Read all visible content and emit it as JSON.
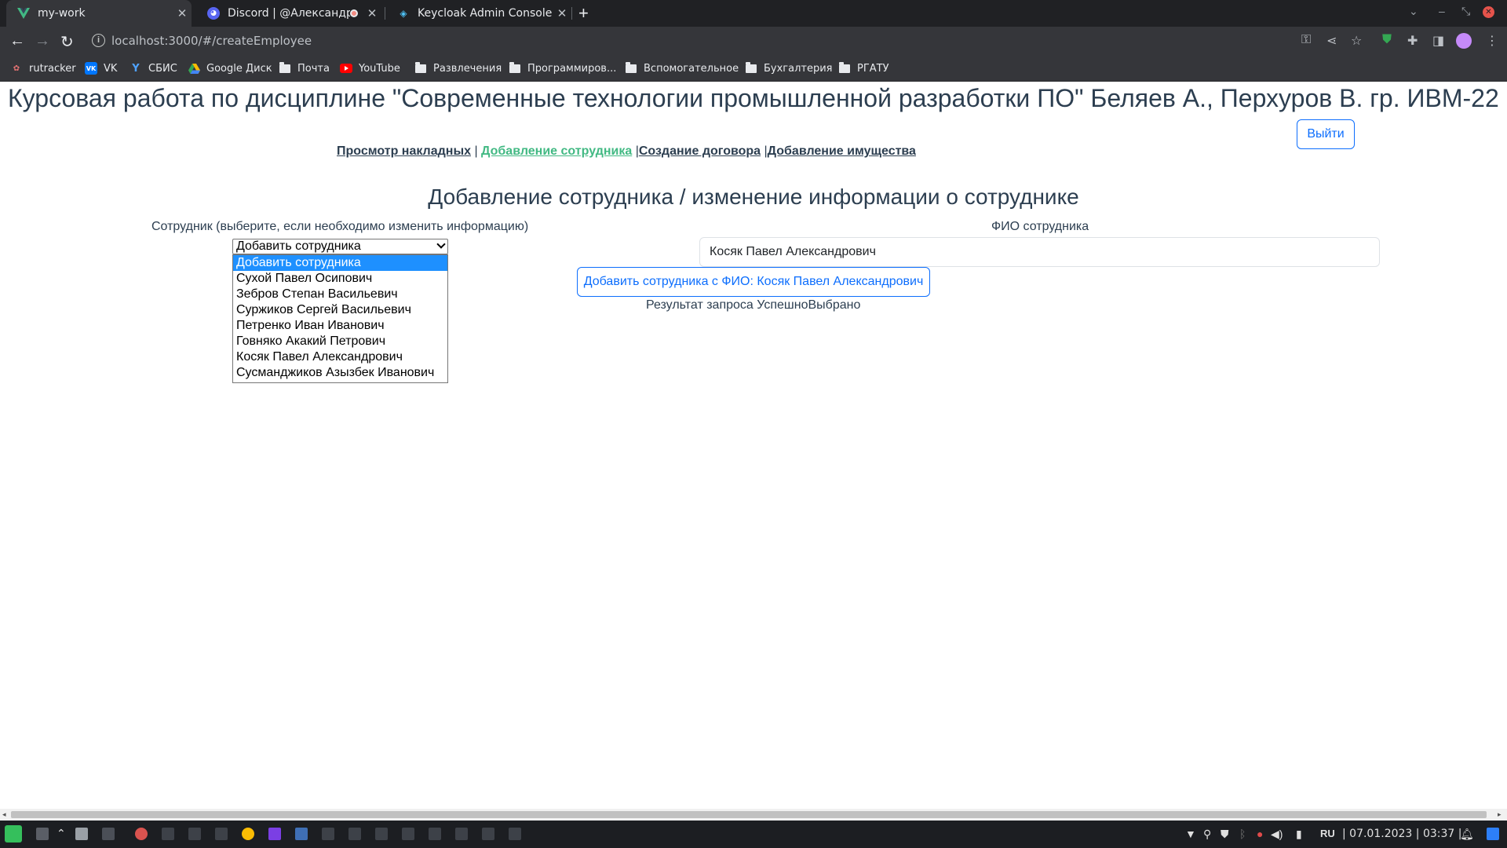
{
  "browser": {
    "tabs": [
      {
        "title": "my-work",
        "icon": "vue-icon",
        "active": true
      },
      {
        "title": "Discord | @Александр Б",
        "icon": "discord-icon",
        "active": false
      },
      {
        "title": "Keycloak Admin Console",
        "icon": "keycloak-icon",
        "active": false
      }
    ],
    "url": "localhost:3000/#/createEmployee",
    "bookmarks": [
      {
        "label": "rutracker",
        "icon": "rutracker-icon"
      },
      {
        "label": "VK",
        "icon": "vk-icon"
      },
      {
        "label": "СБИС",
        "icon": "sbis-icon"
      },
      {
        "label": "Google Диск",
        "icon": "google-drive-icon"
      },
      {
        "label": "Почта",
        "icon": "folder-icon"
      },
      {
        "label": "YouTube",
        "icon": "youtube-icon"
      },
      {
        "label": "Развлечения",
        "icon": "folder-icon"
      },
      {
        "label": "Программиров...",
        "icon": "folder-icon"
      },
      {
        "label": "Вспомогательное",
        "icon": "folder-icon"
      },
      {
        "label": "Бухгалтерия",
        "icon": "folder-icon"
      },
      {
        "label": "РГАТУ",
        "icon": "folder-icon"
      }
    ]
  },
  "page": {
    "course_title": "Курсовая работа по дисциплине \"Современные технологии промышленной разработки ПО\" Беляев А., Перхуров В. гр. ИВМ-22",
    "logout_label": "Выйти",
    "nav": {
      "waybills": "Просмотр накладных",
      "sep1": " | ",
      "add_employee": "Добавление сотрудника",
      "sep2": " |",
      "create_contract": "Создание договора",
      "sep3": " |",
      "add_property": "Добавление имущества"
    },
    "section_title": "Добавление сотрудника / изменение информации о сотруднике",
    "employee_label": "Сотрудник (выберите, если необходимо изменить информацию)",
    "employee_select": {
      "selected": "Добавить сотрудника",
      "options": [
        "Добавить сотрудника",
        "Сухой Павел Осипович",
        "Зебров Степан Васильевич",
        "Суржиков Сергей Васильевич",
        "Петренко Иван Иванович",
        "Говняко Акакий Петрович",
        "Косяк Павел Александрович",
        "Сусманджиков Азызбек Иванович"
      ]
    },
    "fio_label": "ФИО сотрудника",
    "fio_value": "Косяк Павел Александрович",
    "add_button_label": "Добавить сотрудника с ФИО: Косяк Павел Александрович",
    "result_text": "Результат запроса УспешноВыбрано"
  },
  "taskbar": {
    "language": "RU",
    "datetime": "| 07.01.2023 | 03:37 |"
  },
  "colors": {
    "accent_link": "#42b983",
    "primary": "#0d6efd",
    "text": "#2c3e50"
  }
}
